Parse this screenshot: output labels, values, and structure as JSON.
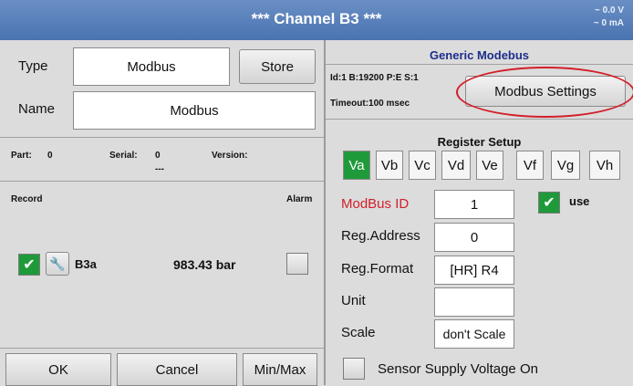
{
  "titlebar": {
    "title": "*** Channel B3 ***",
    "readout_v": "~ 0.0 V",
    "readout_ma": "~ 0 mA"
  },
  "left": {
    "type_label": "Type",
    "type_value": "Modbus",
    "store_label": "Store",
    "name_label": "Name",
    "name_value": "Modbus",
    "part_label": "Part:",
    "part_value": "0",
    "serial_label": "Serial:",
    "serial_value": "0",
    "serial_sub": "---",
    "version_label": "Version:",
    "record_label": "Record",
    "alarm_label": "Alarm",
    "channel_name": "B3a",
    "channel_value": "983.43 bar"
  },
  "right": {
    "generic_title": "Generic Modebus",
    "conn_info": "Id:1 B:19200 P:E S:1",
    "timeout": "Timeout:100 msec",
    "settings_button": "Modbus Settings",
    "register_title": "Register Setup",
    "tabs": [
      "Va",
      "Vb",
      "Vc",
      "Vd",
      "Ve",
      "Vf",
      "Vg",
      "Vh"
    ],
    "modbus_id_label": "ModBus ID",
    "modbus_id_value": "1",
    "use_label": "use",
    "reg_address_label": "Reg.Address",
    "reg_address_value": "0",
    "reg_format_label": "Reg.Format",
    "reg_format_value": "[HR] R4",
    "unit_label": "Unit",
    "unit_value": "",
    "scale_label": "Scale",
    "scale_value": "don't Scale",
    "supply_label": "Sensor Supply Voltage On"
  },
  "bottom": {
    "ok": "OK",
    "cancel": "Cancel",
    "minmax": "Min/Max"
  },
  "colors": {
    "title_bar": "#4a73b0",
    "active_green": "#1f9a3a",
    "highlight_red": "#d21f2a",
    "heading_blue": "#1c2f8a"
  },
  "icons": {
    "check": "check-icon",
    "wrench": "wrench-icon"
  }
}
